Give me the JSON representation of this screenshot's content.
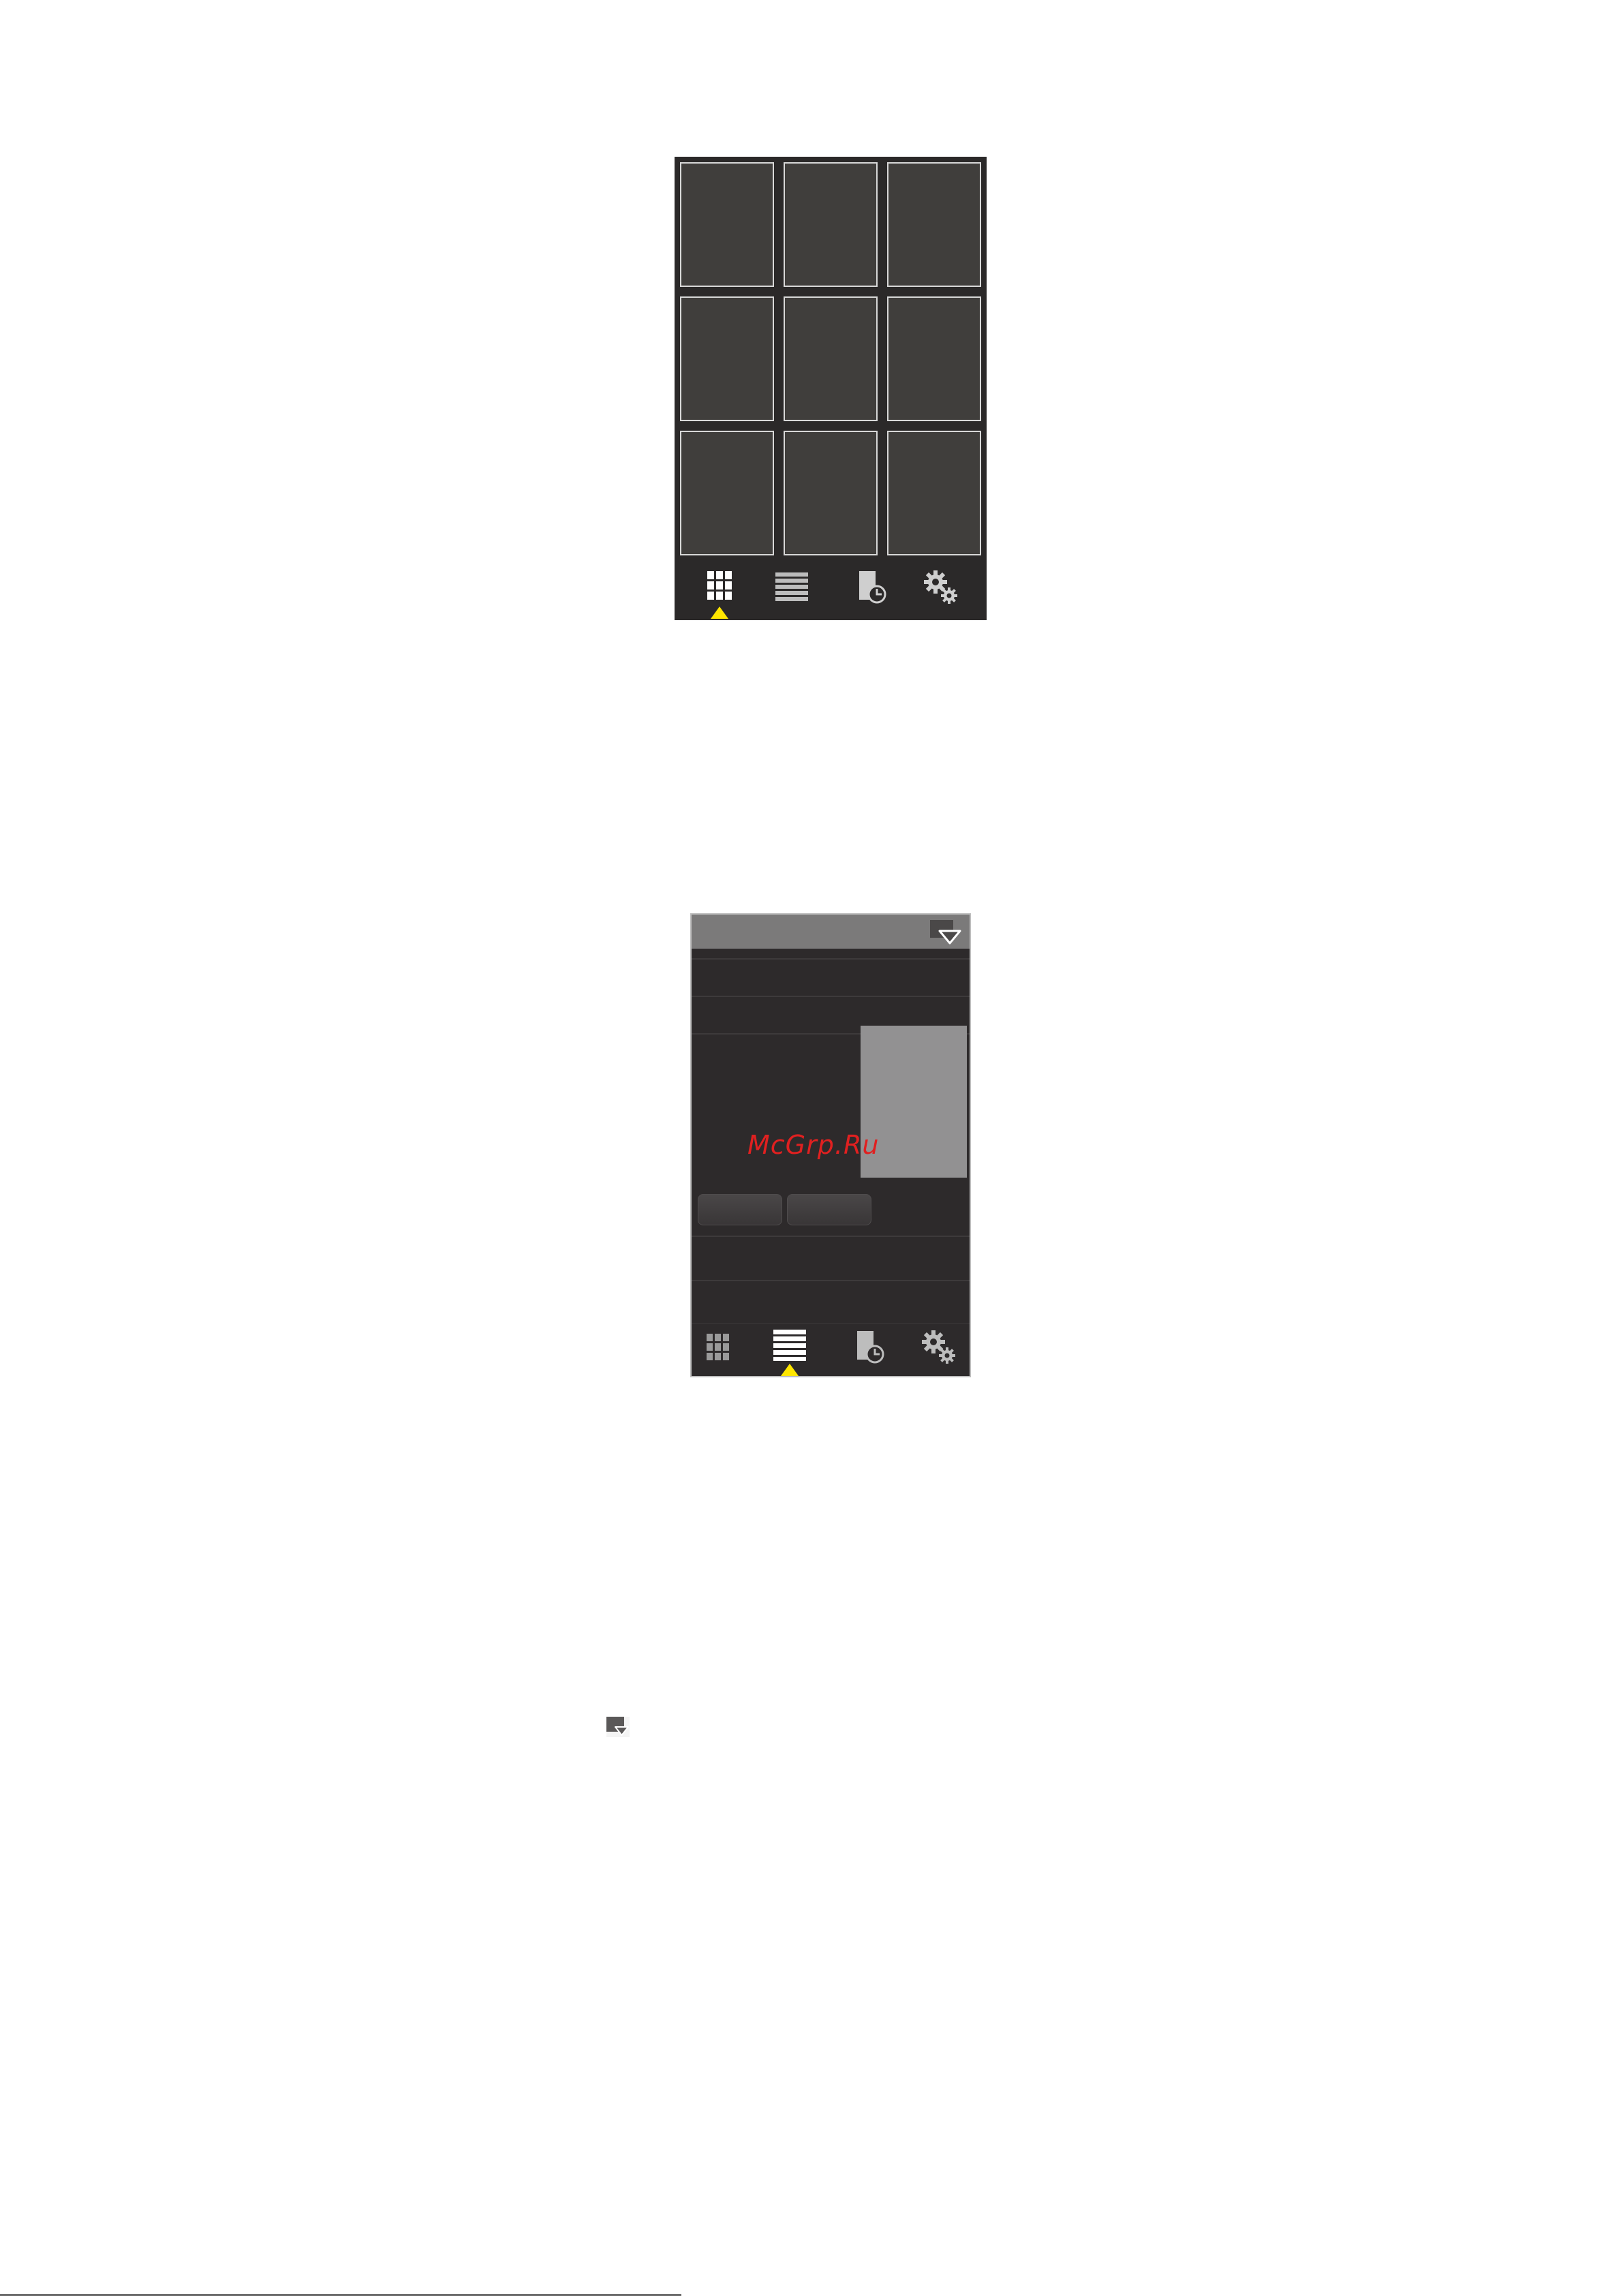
{
  "screens": [
    {
      "id": "grid-view",
      "tiles": 9,
      "active_tab": "grid",
      "tabs": [
        {
          "name": "grid",
          "icon": "grid-icon"
        },
        {
          "name": "list",
          "icon": "list-icon"
        },
        {
          "name": "recent",
          "icon": "document-clock-icon"
        },
        {
          "name": "settings",
          "icon": "gears-icon"
        }
      ]
    },
    {
      "id": "list-view",
      "active_tab": "list",
      "header_icon": "dropdown-icon",
      "tabs": [
        {
          "name": "grid",
          "icon": "grid-icon"
        },
        {
          "name": "list",
          "icon": "list-icon"
        },
        {
          "name": "recent",
          "icon": "document-clock-icon"
        },
        {
          "name": "settings",
          "icon": "gears-icon"
        }
      ]
    }
  ],
  "watermark": "McGrp.Ru",
  "inline_icon": "dropdown-icon",
  "colors": {
    "active_indicator": "#ffe600",
    "screen_bg": "#2b2929",
    "tile_bg": "#403e3c",
    "watermark": "#e02020"
  }
}
